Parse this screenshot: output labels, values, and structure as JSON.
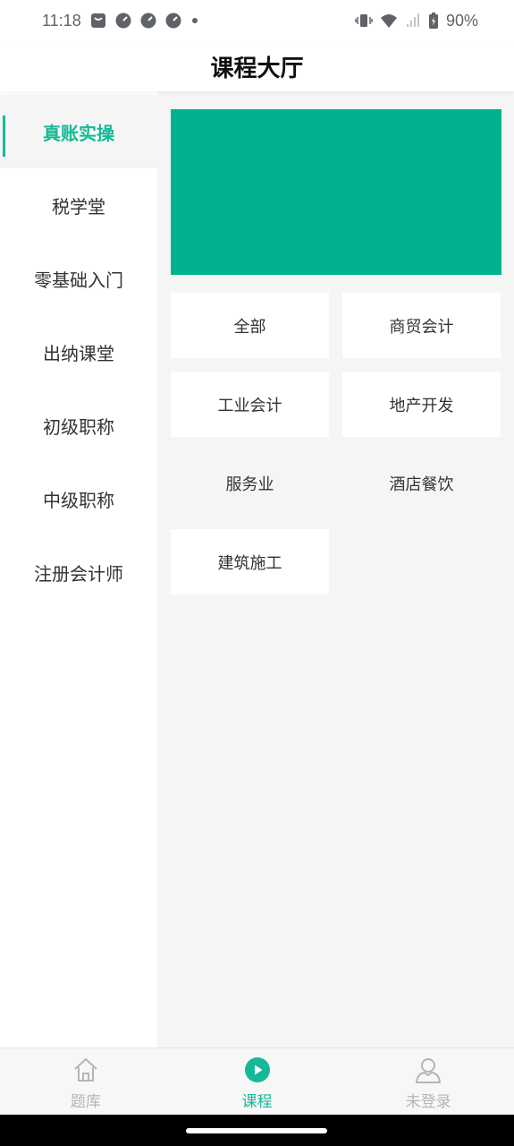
{
  "status": {
    "time": "11:18",
    "battery": "90%"
  },
  "header": {
    "title": "课程大厅"
  },
  "sidebar": {
    "items": [
      {
        "label": "真账实操"
      },
      {
        "label": "税学堂"
      },
      {
        "label": "零基础入门"
      },
      {
        "label": "出纳课堂"
      },
      {
        "label": "初级职称"
      },
      {
        "label": "中级职称"
      },
      {
        "label": "注册会计师"
      }
    ]
  },
  "banner": {
    "color": "#00b28d"
  },
  "categories": [
    {
      "label": "全部"
    },
    {
      "label": "商贸会计"
    },
    {
      "label": "工业会计"
    },
    {
      "label": "地产开发"
    },
    {
      "label": "服务业"
    },
    {
      "label": "酒店餐饮"
    },
    {
      "label": "建筑施工"
    }
  ],
  "tabbar": {
    "items": [
      {
        "label": "题库",
        "icon": "home-icon"
      },
      {
        "label": "课程",
        "icon": "play-circle-icon"
      },
      {
        "label": "未登录",
        "icon": "user-icon"
      }
    ]
  },
  "colors": {
    "accent": "#17b897",
    "background": "#f4f5f4"
  }
}
